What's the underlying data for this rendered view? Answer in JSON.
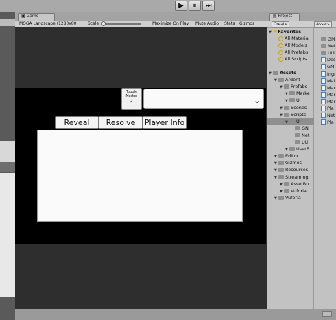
{
  "toolbar": {
    "play_icon": "▶",
    "pause_icon": "⏸",
    "step_icon": "⏭"
  },
  "game": {
    "tab_label": "Game",
    "resolution": "MOGA Landscape (1280x80",
    "scale_label": "Scale",
    "toolbar_items": [
      "Maximize On Play",
      "Mute Audio",
      "Stats",
      "Gizmos"
    ],
    "toggle_label": "Toggle Marker",
    "toggle_check": "✓",
    "dropdown_chevron": "⌄",
    "buttons": [
      "Reveal",
      "Resolve",
      "Player Info"
    ]
  },
  "project": {
    "tab_label": "Project",
    "create_label": "Create",
    "assets_label": "Assets",
    "favorites": {
      "label": "Favorites",
      "items": [
        "All Materia",
        "All Models",
        "All Prefabs",
        "All Scripts"
      ]
    },
    "tree": [
      {
        "label": "Assets",
        "depth": 0,
        "bold": true
      },
      {
        "label": "Ardent",
        "depth": 1
      },
      {
        "label": "Prefabs",
        "depth": 2
      },
      {
        "label": "Marke",
        "depth": 3
      },
      {
        "label": "UI",
        "depth": 3
      },
      {
        "label": "Scenes",
        "depth": 2
      },
      {
        "label": "Scripts",
        "depth": 2
      },
      {
        "label": "UI",
        "depth": 3,
        "selected": true
      },
      {
        "label": "GN",
        "depth": 4
      },
      {
        "label": "Net",
        "depth": 4
      },
      {
        "label": "Uti",
        "depth": 4
      },
      {
        "label": "UserB",
        "depth": 3
      },
      {
        "label": "Editor",
        "depth": 1
      },
      {
        "label": "Gizmos",
        "depth": 1
      },
      {
        "label": "Resources",
        "depth": 1
      },
      {
        "label": "Streaming",
        "depth": 1
      },
      {
        "label": "AssetBu",
        "depth": 2
      },
      {
        "label": "Vuforia",
        "depth": 2
      },
      {
        "label": "Vuforia",
        "depth": 1
      }
    ],
    "asset_items": [
      "GM",
      "Net",
      "Util",
      "Des",
      "GM",
      "Ingr",
      "Mai",
      "Mar",
      "Mar",
      "Mar",
      "Pla",
      "Net",
      "Pla"
    ]
  }
}
